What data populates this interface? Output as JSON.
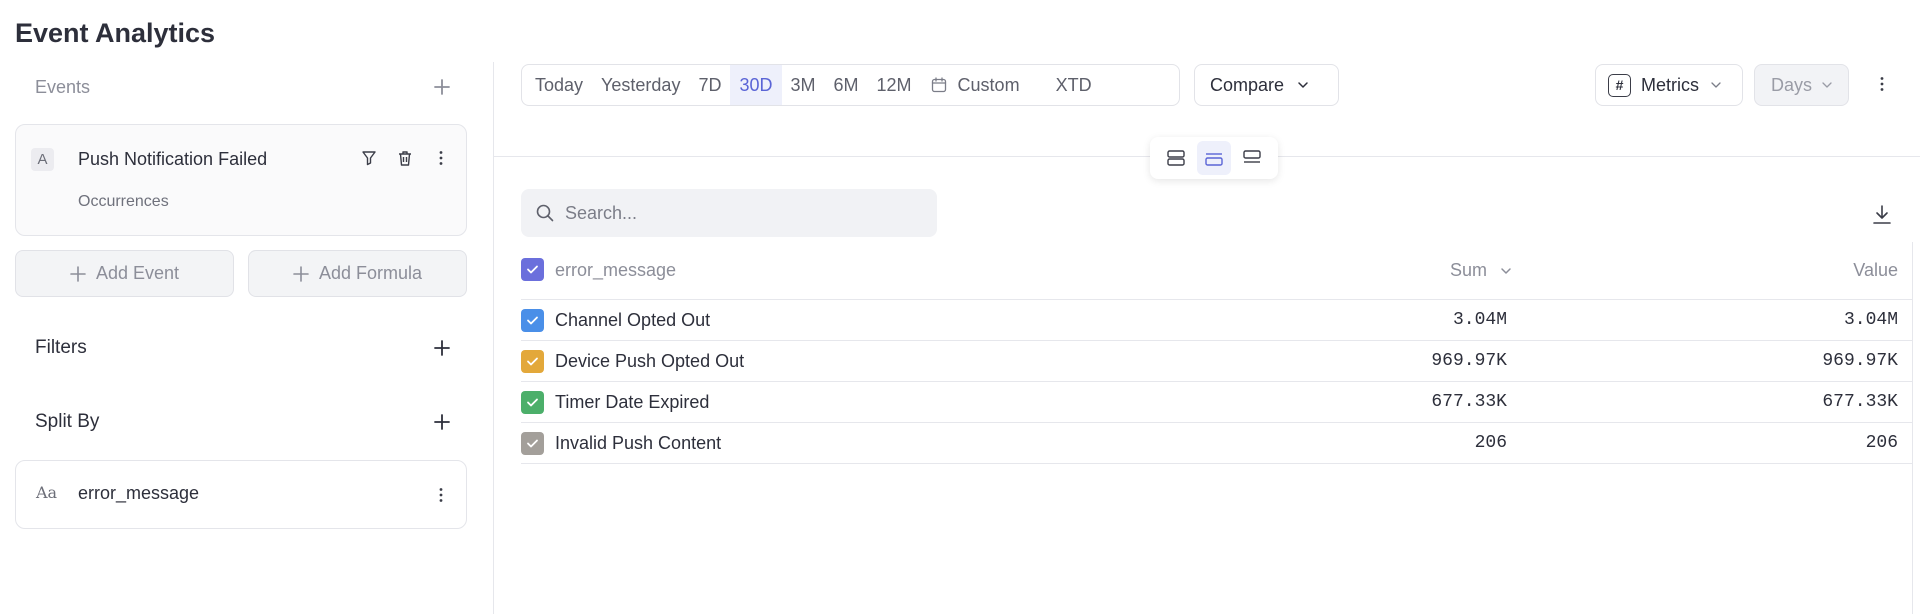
{
  "page": {
    "title": "Event Analytics"
  },
  "sidebar": {
    "events_label": "Events",
    "event": {
      "letter": "A",
      "name": "Push Notification Failed",
      "measure": "Occurrences"
    },
    "add_event_label": "Add Event",
    "add_formula_label": "Add Formula",
    "filters_label": "Filters",
    "split_by_label": "Split By",
    "split": {
      "type_icon": "Aa",
      "name": "error_message"
    }
  },
  "toolbar": {
    "ranges": [
      "Today",
      "Yesterday",
      "7D",
      "30D",
      "3M",
      "6M",
      "12M"
    ],
    "active_range": "30D",
    "custom_label": "Custom",
    "xtd_label": "XTD",
    "compare_label": "Compare",
    "metrics_label": "Metrics",
    "metrics_icon": "#",
    "days_label": "Days"
  },
  "search": {
    "placeholder": "Search..."
  },
  "table": {
    "header": {
      "name": "error_message",
      "sum": "Sum",
      "value": "Value"
    },
    "header_checkbox_color": "#6b6fdc",
    "rows": [
      {
        "name": "Channel Opted Out",
        "sum": "3.04M",
        "value": "3.04M",
        "color": "#4a8fe8"
      },
      {
        "name": "Device Push Opted Out",
        "sum": "969.97K",
        "value": "969.97K",
        "color": "#e3a83a"
      },
      {
        "name": "Timer Date Expired",
        "sum": "677.33K",
        "value": "677.33K",
        "color": "#4caf6a"
      },
      {
        "name": "Invalid Push Content",
        "sum": "206",
        "value": "206",
        "color": "#a39f9a"
      }
    ]
  }
}
